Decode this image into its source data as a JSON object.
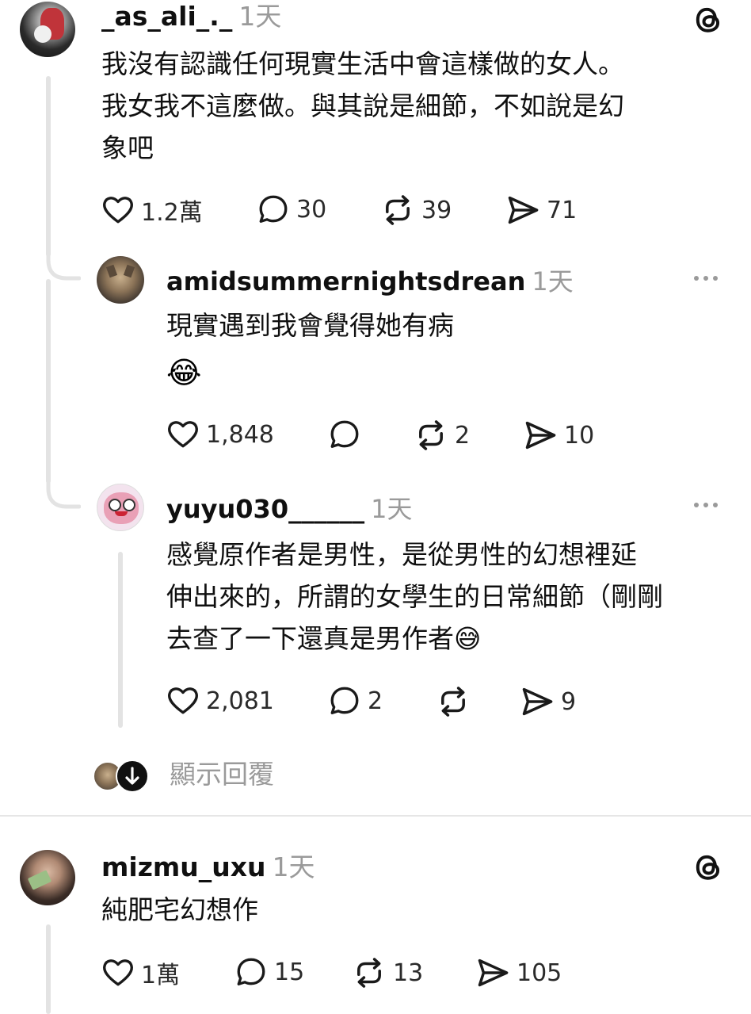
{
  "post1": {
    "username": "_as_ali_._",
    "time": "1天",
    "text_lines": [
      "我沒有認識任何現實生活中會這樣做的女人。",
      "我女我不這麼做。與其說是細節，不如說是幻",
      "象吧"
    ],
    "likes": "1.2萬",
    "replies": "30",
    "reposts": "39",
    "shares": "71"
  },
  "reply1": {
    "username": "amidsummernightsdrean",
    "time": "1天",
    "text": "現實遇到我會覺得她有病",
    "emoji": "😂",
    "likes": "1,848",
    "replies": "",
    "reposts": "2",
    "shares": "10"
  },
  "reply2": {
    "username": "yuyu030______",
    "time": "1天",
    "text_lines": [
      "感覺原作者是男性，是從男性的幻想裡延",
      "伸出來的，所謂的女學生的日常細節（剛剛",
      "去查了一下還真是男作者😅"
    ],
    "likes": "2,081",
    "replies": "2",
    "reposts": "",
    "shares": "9"
  },
  "show_replies": {
    "label": "顯示回覆"
  },
  "post2": {
    "username": "mizmu_uxu",
    "time": "1天",
    "text": "純肥宅幻想作",
    "likes": "1萬",
    "replies": "15",
    "reposts": "13",
    "shares": "105"
  },
  "icons": {
    "threads_logo": "threads-logo-icon",
    "more": "more-dots-icon",
    "like": "heart-icon",
    "reply": "comment-bubble-icon",
    "repost": "repost-icon",
    "share": "send-icon",
    "expand": "arrow-down-icon"
  },
  "colors": {
    "text": "#101010",
    "muted": "#9a9a9a",
    "line": "#e3e3e3"
  }
}
